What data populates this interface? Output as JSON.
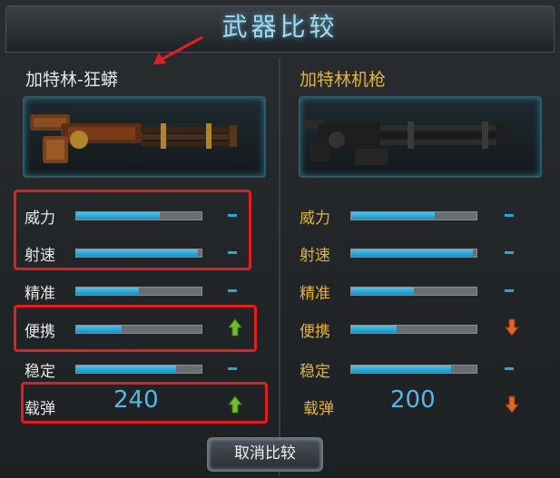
{
  "window": {
    "title": "武器比较"
  },
  "left_weapon": {
    "name": "加特林-狂蟒",
    "stats": [
      {
        "label": "威力",
        "level": 0.67,
        "change": "none"
      },
      {
        "label": "射速",
        "level": 0.97,
        "change": "none"
      },
      {
        "label": "精准",
        "level": 0.5,
        "change": "none"
      },
      {
        "label": "便携",
        "level": 0.36,
        "change": "up"
      },
      {
        "label": "稳定",
        "level": 0.8,
        "change": "none"
      }
    ],
    "ammo": {
      "label": "载弹",
      "value": "240",
      "change": "up"
    }
  },
  "right_weapon": {
    "name": "加特林机枪",
    "stats": [
      {
        "label": "威力",
        "level": 0.67,
        "change": "none"
      },
      {
        "label": "射速",
        "level": 0.97,
        "change": "none"
      },
      {
        "label": "精准",
        "level": 0.5,
        "change": "none"
      },
      {
        "label": "便携",
        "level": 0.36,
        "change": "down"
      },
      {
        "label": "稳定",
        "level": 0.8,
        "change": "none"
      }
    ],
    "ammo": {
      "label": "载弹",
      "value": "200",
      "change": "down"
    }
  },
  "buttons": {
    "cancel_compare": "取消比较"
  },
  "colors": {
    "bar_fill": "#2aa6dd",
    "up_arrow": "#6fbf2a",
    "down_arrow": "#e0662a",
    "annotation": "#e02020",
    "right_label": "#e0b43c"
  },
  "icons": {
    "up": "green-up-arrow-icon",
    "down": "orange-down-arrow-icon",
    "none": "dash-icon"
  }
}
